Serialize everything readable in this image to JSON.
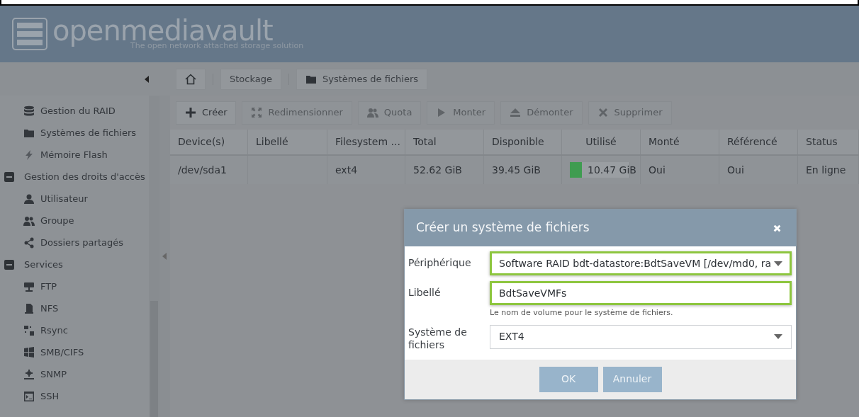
{
  "header": {
    "logo_text": "openmediavault",
    "tagline": "The open network attached storage solution"
  },
  "breadcrumb": [
    {
      "label": "Stockage",
      "kind": "text"
    },
    {
      "label": "Systèmes de fichiers",
      "kind": "folder"
    }
  ],
  "sidebar": {
    "items": [
      {
        "kind": "item",
        "label": "Gestion du RAID"
      },
      {
        "kind": "item",
        "label": "Systèmes de fichiers"
      },
      {
        "kind": "item",
        "label": "Mémoire Flash"
      },
      {
        "kind": "group",
        "label": "Gestion des droits d'accès",
        "expanded": true
      },
      {
        "kind": "item",
        "label": "Utilisateur"
      },
      {
        "kind": "item",
        "label": "Groupe"
      },
      {
        "kind": "item",
        "label": "Dossiers partagés"
      },
      {
        "kind": "group",
        "label": "Services",
        "expanded": true
      },
      {
        "kind": "item",
        "label": "FTP"
      },
      {
        "kind": "item",
        "label": "NFS"
      },
      {
        "kind": "item",
        "label": "Rsync"
      },
      {
        "kind": "item",
        "label": "SMB/CIFS"
      },
      {
        "kind": "item",
        "label": "SNMP"
      },
      {
        "kind": "item",
        "label": "SSH"
      }
    ]
  },
  "toolbar": [
    {
      "label": "Créer",
      "disabled": false
    },
    {
      "label": "Redimensionner",
      "disabled": true
    },
    {
      "label": "Quota",
      "disabled": true
    },
    {
      "label": "Monter",
      "disabled": true
    },
    {
      "label": "Démonter",
      "disabled": true
    },
    {
      "label": "Supprimer",
      "disabled": true
    }
  ],
  "table": {
    "columns": [
      "Device(s)",
      "Libellé",
      "Filesystem ...",
      "Total",
      "Disponible",
      "Utilisé",
      "Monté",
      "Référencé",
      "Status"
    ],
    "rows": [
      {
        "device": "/dev/sda1",
        "label": "",
        "filesystem": "ext4",
        "total": "52.62 GiB",
        "available": "39.45 GiB",
        "used": "10.47 GiB",
        "level": 0.2,
        "mounted": "Oui",
        "referenced": "Oui",
        "status": "En ligne"
      }
    ]
  },
  "dialog": {
    "title": "Créer un système de fichiers",
    "fields": [
      {
        "label": "Périphérique",
        "kind": "select",
        "value": "Software RAID bdt-datastore:BdtSaveVM [/dev/md0, ra",
        "highlighted": true
      },
      {
        "label": "Libellé",
        "kind": "text",
        "value": "BdtSaveVMFs",
        "highlighted": true,
        "help": "Le nom de volume pour le système de fichiers."
      },
      {
        "label": "Système de fichiers",
        "kind": "select",
        "value": "EXT4",
        "highlighted": false
      }
    ],
    "buttons": [
      "OK",
      "Annuler"
    ]
  }
}
